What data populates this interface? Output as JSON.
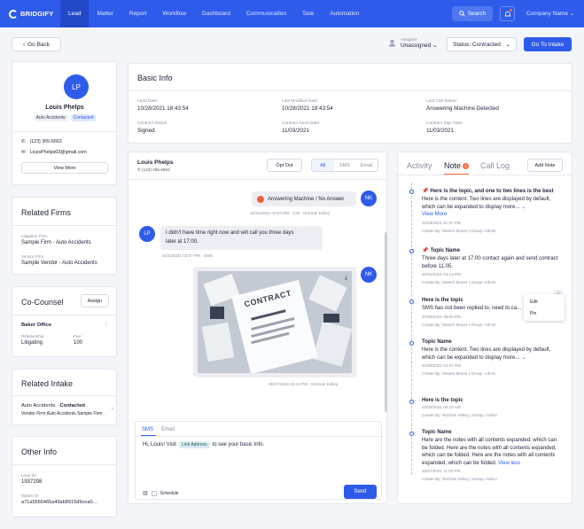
{
  "nav": {
    "brand": "BRIDGIFY",
    "items": [
      "Lead",
      "Matter",
      "Report",
      "Workflow",
      "Dashboard",
      "Communication",
      "Task",
      "Automation"
    ],
    "active": "Lead",
    "search_label": "Search",
    "company": "Company Name"
  },
  "toolbar": {
    "back": "Go Back",
    "assignee_label": "Assignee",
    "assignee_value": "Unassigned",
    "status": "Status: Contracted",
    "go_intake": "Go To Intake"
  },
  "profile": {
    "initials": "LP",
    "name": "Louis Phelps",
    "tags": [
      "Auto Accidents",
      "Contacted"
    ],
    "phone": "(123) 355-6663",
    "email": "LouisPhelps03@gmail.com",
    "view_more": "View More"
  },
  "related_firms": {
    "title": "Related Firms",
    "litigation_label": "Litigation Firm:",
    "litigation_value": "Sample Firm - Auto Accidents",
    "vendor_label": "Vendor Firm:",
    "vendor_value": "Sample Vendor - Auto Accidents"
  },
  "co_counsel": {
    "title": "Co-Counsel",
    "assign": "Assign",
    "office": "Baker Office",
    "relationship_label": "Relationship:",
    "relationship_value": "Litigating",
    "fee_label": "Fee:",
    "fee_value": "100"
  },
  "related_intake": {
    "title": "Related Intake",
    "item_name": "Auto Accidents",
    "item_status": "Contacted",
    "item_vendor": "Vendor Firm:Auto Accidents Sample Firm"
  },
  "other_info": {
    "title": "Other Info",
    "lead_label": "Lead ID:",
    "lead_value": "1937298",
    "matter_label": "Matter ID:",
    "matter_value": "a71a5566465a49ab8915d9cea0..."
  },
  "basic_info": {
    "title": "Basic Info",
    "fields": [
      {
        "label": "Lead Date:",
        "value": "10/28/2021 18:43:54"
      },
      {
        "label": "Last Modified Date:",
        "value": "10/28/2021 18:43:54"
      },
      {
        "label": "Last Call Status:",
        "value": "Answering Machine Detected"
      },
      {
        "label": "Contract Status:",
        "value": "Signed"
      },
      {
        "label": "Contract Send Date:",
        "value": "11/03/2021"
      },
      {
        "label": "Contract Sign Date:",
        "value": "11/03/2021"
      }
    ]
  },
  "chat": {
    "name": "Louis Phelps",
    "phone": "(123) 355-6663",
    "opt_out": "Opt Out",
    "filters": [
      "All",
      "SMS",
      "Email"
    ],
    "active_filter": "All",
    "msg1": {
      "text": "Answering Machine / No Answer",
      "meta": "10/31/2021 02:03 PM · Call · Norman Kelley",
      "initials": "NK"
    },
    "msg2": {
      "line1": "I didn't have time right now and will call you three days",
      "line2": "later at 17:00.",
      "meta": "10/31/2021 02:07 PM · SMS",
      "initials": "LP"
    },
    "msg3": {
      "image_label": "CONTRACT",
      "meta": "05/17/2022 03:12 PM · Norman Kelley",
      "initials": "NK"
    },
    "compose": {
      "tabs": [
        "SMS",
        "Email"
      ],
      "text_before": "Hi, Louis! Visit",
      "link": "Link Address",
      "text_after": "to see your basic Info.",
      "schedule": "Schedule",
      "send": "Send"
    }
  },
  "notes_panel": {
    "tabs": [
      "Activity",
      "Note",
      "Call Log"
    ],
    "active": "Note",
    "note_count": "2",
    "add_note": "Add Note",
    "menu": [
      "Edit",
      "Pin"
    ],
    "notes": [
      {
        "title": "Here is the topic, and one to two lines is the best",
        "body": "Here is the content. Two lines are displayed by default, which can be expanded to display more...",
        "link": "View More",
        "date": "11/03/2021 01:37 PM",
        "creator": "Create By: Steven Moore",
        "group": "Group: Admin"
      },
      {
        "title": "Topic Name",
        "body": "Three days later at 17:00 contact again and send contract before 11.05.",
        "date": "10/31/2021 03:13 PM",
        "creator": "Create By: Steven Moore",
        "group": "Group: Admin"
      },
      {
        "title": "Here is the topic",
        "body": "SMS has not been replied to, need to ca...",
        "date": "10/28/2021 06:00 PM",
        "creator": "Create By: Steven Moore",
        "group": "Group: Admin"
      },
      {
        "title": "Topic Name",
        "body": "Here is the content. Two lines are displayed by default, which can be expanded to display more...",
        "date": "10/28/2021 01:37 PM",
        "creator": "Create By: Steven Moore",
        "group": "Group: Admin"
      },
      {
        "title": "Here is the topic",
        "date": "10/28/2021 09:10 AM",
        "creator": "Create By: Norman Kelley",
        "group": "Group: Admin"
      },
      {
        "title": "Topic Name",
        "body": "Here are the notes with all contents expanded, which can be folded. Here are the notes with all contents expanded, which can be folded. Here are the notes with all contents expanded, which can be folded.",
        "link": "View less",
        "date": "10/27/2021 11:03 PM",
        "creator": "Create By: Norman Kelley",
        "group": "Group: Admin"
      }
    ]
  },
  "colors": {
    "primary": "#2f5bea",
    "accent": "#ff6a3d",
    "background": "#f3f5f9"
  }
}
